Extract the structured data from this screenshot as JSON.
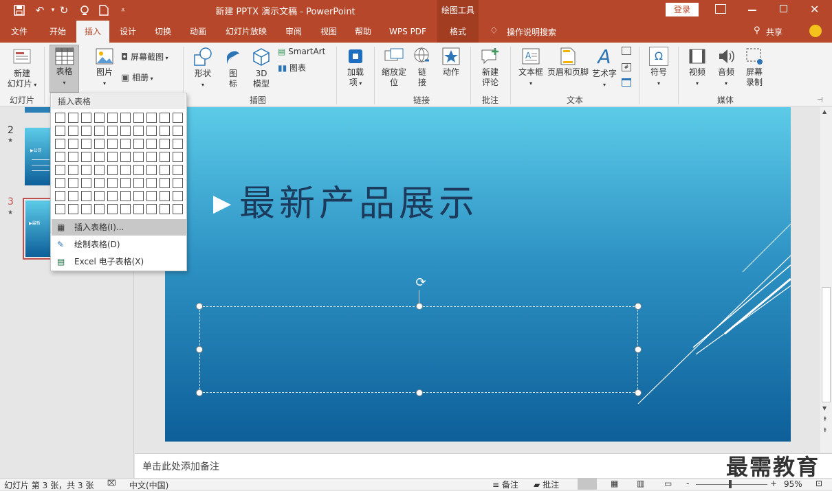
{
  "titlebar": {
    "doc_title": "新建 PPTX 演示文稿 - PowerPoint",
    "context_tab": "绘图工具",
    "login": "登录"
  },
  "tabs": [
    "文件",
    "开始",
    "插入",
    "设计",
    "切换",
    "动画",
    "幻灯片放映",
    "审阅",
    "视图",
    "帮助",
    "WPS PDF",
    "格式"
  ],
  "tell_me": "操作说明搜索",
  "share": "共享",
  "ribbon": {
    "new_slide": "新建\n幻灯片",
    "table": "表格",
    "image": "图片",
    "screenshot": "屏幕截图",
    "album": "相册",
    "shapes": "形状",
    "icons": "图\n标",
    "model3d": "3D\n模型",
    "smartart": "SmartArt",
    "chart": "图表",
    "addins": "加载\n项",
    "zoom": "缩放定\n位",
    "link": "链\n接",
    "action": "动作",
    "new_comment": "新建\n评论",
    "textbox": "文本框",
    "header_footer": "页眉和页脚",
    "wordart": "艺术字",
    "symbol": "符号",
    "video": "视频",
    "audio": "音频",
    "screen_record": "屏幕\n录制",
    "groups": {
      "slides": "幻灯片",
      "illustrations": "插图",
      "links": "链接",
      "comments": "批注",
      "text": "文本",
      "media": "媒体"
    }
  },
  "dropdown": {
    "header": "插入表格",
    "insert_table": "插入表格(I)...",
    "draw_table": "绘制表格(D)",
    "excel_table": "Excel 电子表格(X)"
  },
  "thumbs": [
    {
      "number": "2",
      "star": "★",
      "text": "▶公司"
    },
    {
      "number": "3",
      "star": "★",
      "text": "▶最新"
    }
  ],
  "slide": {
    "title": "最新产品展示",
    "arrow": "▶"
  },
  "notes_placeholder": "单击此处添加备注",
  "watermark": "最需教育",
  "status": {
    "slide_info": "幻灯片 第 3 张，共 3 张",
    "language": "中文(中国)",
    "notes": "备注",
    "comments": "批注",
    "zoom": "95%",
    "minus": "-",
    "plus": "+"
  },
  "colors": {
    "accent": "#b7472a",
    "ribbon_bg": "#f3f3f3",
    "slide_top": "#5ccbe8",
    "slide_bottom": "#0d5f99",
    "title_text": "#1b3a5c"
  }
}
